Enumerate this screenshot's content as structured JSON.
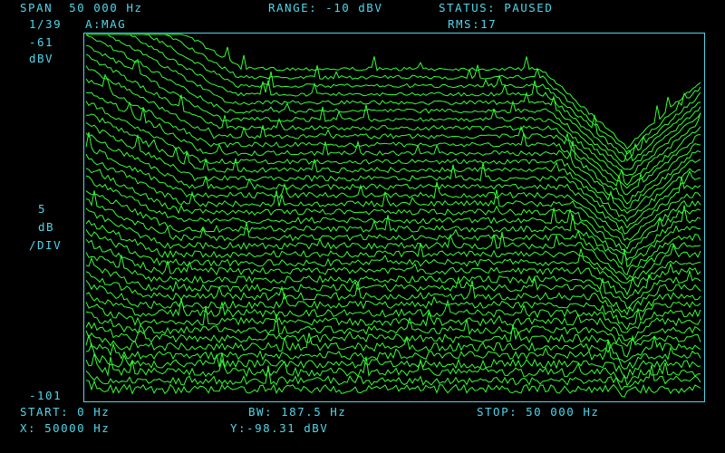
{
  "header": {
    "span": "SPAN  50 000 Hz",
    "range": "RANGE: -10 dBV",
    "status": "STATUS: PAUSED",
    "record": "1/39",
    "channel": "A:MAG",
    "rms": "RMS:17"
  },
  "scale": {
    "top_value": "-61",
    "top_unit": "dBV",
    "per_div_value": "5",
    "per_div_unit": "dB",
    "per_div_label": "/DIV",
    "bottom_value": "-101"
  },
  "footer": {
    "start": "START: 0 Hz",
    "bw": "BW: 187.5 Hz",
    "stop": "STOP: 50 000 Hz",
    "marker_x": "X: 50000 Hz",
    "marker_y": "Y:-98.31 dBV"
  },
  "colors": {
    "text": "#4fd6ea",
    "trace": "#33ff33",
    "background": "#000000"
  }
}
